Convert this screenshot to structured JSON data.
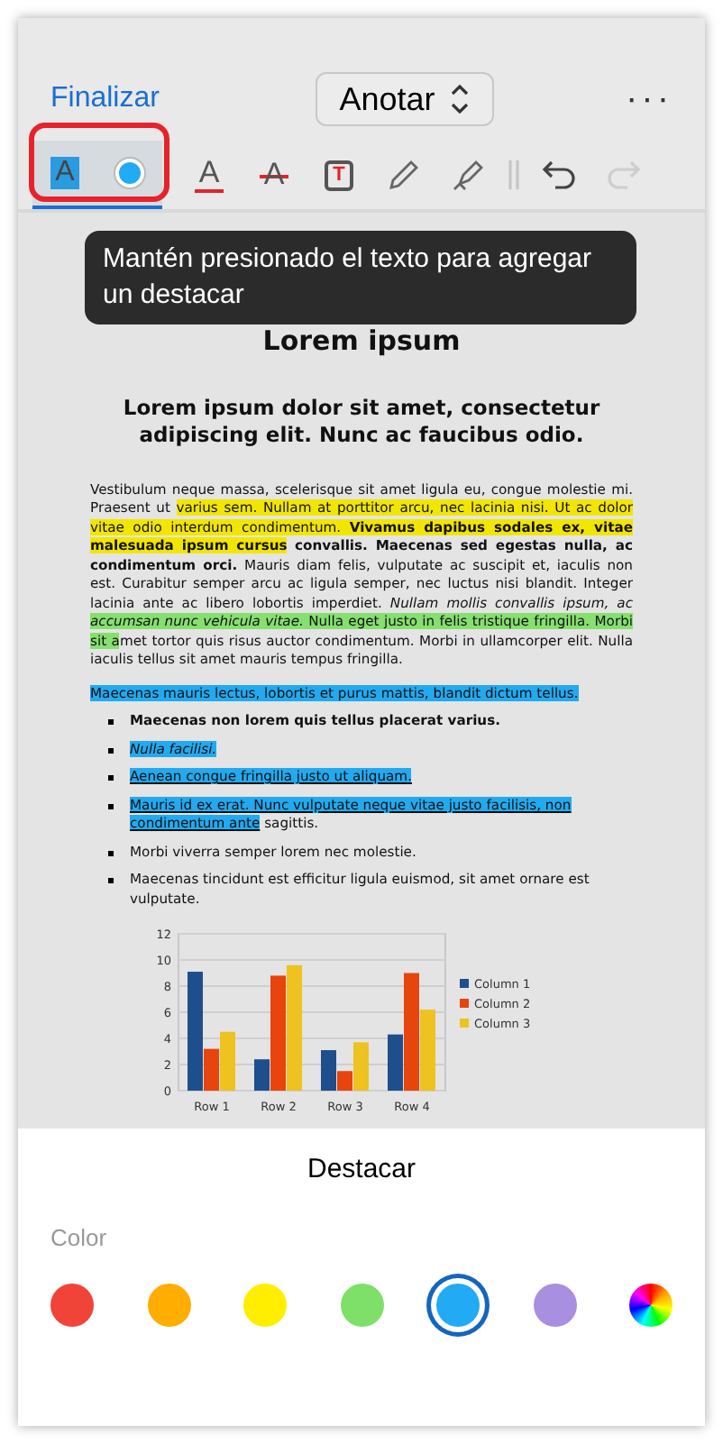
{
  "header": {
    "done": "Finalizar",
    "mode": "Anotar",
    "more": "···"
  },
  "tools": [
    {
      "kind": "highlight",
      "label": "A",
      "selected": true,
      "disabled": false
    },
    {
      "kind": "color",
      "selected": true,
      "disabled": false
    },
    {
      "kind": "textcolor",
      "label": "A",
      "selected": false,
      "disabled": false
    },
    {
      "kind": "strike",
      "label": "A",
      "selected": false,
      "disabled": false
    },
    {
      "kind": "textbox",
      "label": "T",
      "selected": false,
      "disabled": false
    },
    {
      "kind": "pencil",
      "selected": false,
      "disabled": false
    },
    {
      "kind": "marker",
      "selected": false,
      "disabled": false
    },
    {
      "kind": "separator",
      "selected": false,
      "disabled": false
    },
    {
      "kind": "undo",
      "selected": false,
      "disabled": false
    },
    {
      "kind": "redo",
      "selected": false,
      "disabled": true
    }
  ],
  "tooltip": "Mantén presionado el texto para agregar un destacar",
  "document": {
    "title": "Lorem ipsum",
    "subtitle": "Lorem ipsum dolor sit amet, consectetur adipiscing elit. Nunc ac faucibus odio.",
    "paragraph": [
      {
        "text": "Vestibulum neque massa, scelerisque sit amet ligula eu, congue molestie mi. Praesent ut "
      },
      {
        "text": "varius sem. Nullam at porttitor arcu, nec lacinia nisi. Ut ac dolor vitae odio interdum condimentum. **Vivamus dapibus sodales ex, vitae malesuada ipsum cursus**",
        "color": "#f2e600"
      },
      {
        "text": " **convallis. Maecenas sed egestas nulla, ac condimentum orci.** Mauris diam felis, vulputate ac suscipit et, iaculis non est. Curabitur semper arcu ac ligula semper, nec luctus nisi blandit. Integer lacinia ante ac libero lobortis imperdiet. *Nullam mollis convallis ipsum, ac* "
      },
      {
        "text": "*accumsan nunc vehicula vitae.* Nulla eget justo in felis tristique fringilla. Morbi sit a",
        "color": "#86e070"
      },
      {
        "text": "met tortor quis risus auctor condimentum. Morbi in ullamcorper elit. Nulla iaculis tellus sit amet mauris tempus fringilla."
      }
    ],
    "line": {
      "text": "Maecenas mauris lectus, lobortis et purus mattis, blandit dictum tellus.",
      "color": "#22aaf0"
    },
    "bullets": [
      {
        "kind": "bold",
        "segments": [
          {
            "text": "Maecenas non lorem quis tellus placerat varius."
          }
        ]
      },
      {
        "kind": "italic",
        "segments": [
          {
            "text": "Nulla facilisi.",
            "color": "#22aaf0"
          }
        ]
      },
      {
        "kind": "underlined",
        "segments": [
          {
            "text": "Aenean congue fringilla justo ut aliquam.",
            "color": "#22aaf0"
          }
        ]
      },
      {
        "kind": "underlined",
        "segments": [
          {
            "text": "Mauris id ex erat. Nunc vulputate neque vitae justo facilisis, non condimentum ante",
            "color": "#22aaf0"
          },
          {
            "text": " sagittis."
          }
        ]
      },
      {
        "kind": "plain",
        "segments": [
          {
            "text": "Morbi viverra semper lorem nec molestie."
          }
        ]
      },
      {
        "kind": "plain",
        "segments": [
          {
            "text": "Maecenas tincidunt est efficitur ligula euismod, sit amet ornare est vulputate."
          }
        ]
      }
    ],
    "chart_data": {
      "type": "bar",
      "grid": true,
      "legend": "right",
      "categories": [
        "Row 1",
        "Row 2",
        "Row 3",
        "Row 4"
      ],
      "series": [
        {
          "name": "Column 1",
          "color": "#1f4e8c",
          "values": [
            9.1,
            2.4,
            3.1,
            4.3
          ]
        },
        {
          "name": "Column 2",
          "color": "#e8440e",
          "values": [
            3.2,
            8.8,
            1.5,
            9.0
          ]
        },
        {
          "name": "Column 3",
          "color": "#eec21f",
          "values": [
            4.5,
            9.6,
            3.7,
            6.2
          ]
        }
      ],
      "ylim": [
        0,
        12
      ],
      "yticks": [
        0,
        2,
        4,
        6,
        8,
        10,
        12
      ]
    }
  },
  "sheet": {
    "title": "Destacar",
    "section": "Color",
    "swatches": [
      {
        "kind": "solid",
        "color": "#f04438",
        "selected": false
      },
      {
        "kind": "solid",
        "color": "#ffad00",
        "selected": false
      },
      {
        "kind": "solid",
        "color": "#ffee00",
        "selected": false
      },
      {
        "kind": "solid",
        "color": "#7ee069",
        "selected": false
      },
      {
        "kind": "solid",
        "color": "#22aaf5",
        "selected": true
      },
      {
        "kind": "solid",
        "color": "#a98fe0",
        "selected": false
      },
      {
        "kind": "picker",
        "selected": false
      }
    ]
  }
}
